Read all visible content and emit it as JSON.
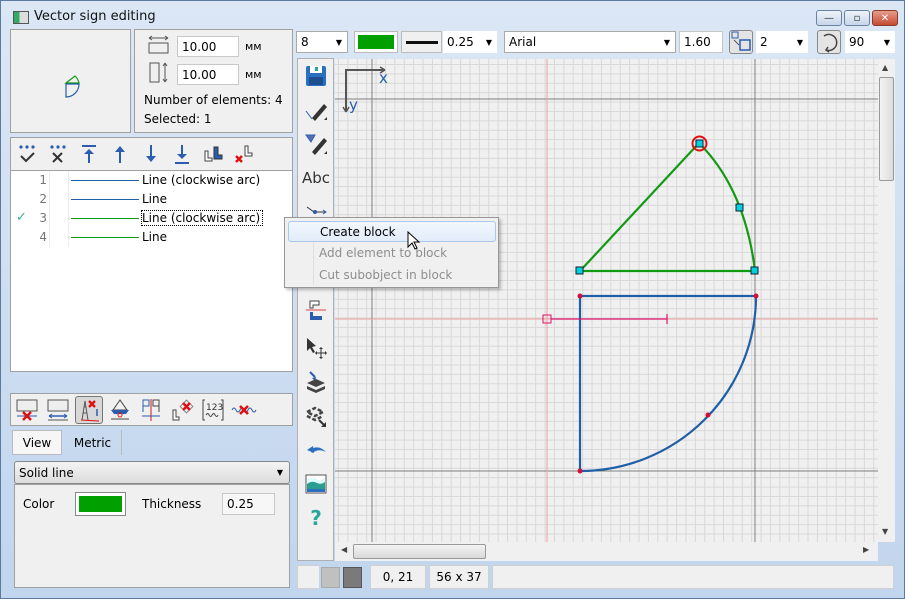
{
  "window": {
    "title": "Vector sign editing",
    "controls": {
      "minimize": "—",
      "maximize": "▫",
      "close": "✕"
    }
  },
  "size_panel": {
    "width_value": "10.00",
    "height_value": "10.00",
    "unit": "мм",
    "elements_label": "Number of elements: 4",
    "selected_label": "Selected: 1"
  },
  "element_list": {
    "toolbar": [
      "select-all-icon",
      "deselect-all-icon",
      "move-top-icon",
      "move-up-icon",
      "move-down-icon",
      "move-bottom-icon",
      "group-icon",
      "ungroup-icon"
    ],
    "rows": [
      {
        "num": "1",
        "check": "",
        "color": "#1f5fa8",
        "label": "Line (clockwise arc)"
      },
      {
        "num": "2",
        "check": "",
        "color": "#1f5fa8",
        "label": "Line"
      },
      {
        "num": "3",
        "check": "✓",
        "color": "#139a13",
        "label": "Line (clockwise arc)"
      },
      {
        "num": "4",
        "check": "",
        "color": "#139a13",
        "label": "Line"
      }
    ]
  },
  "props": {
    "tabs": [
      {
        "label": "View"
      },
      {
        "label": "Metric"
      }
    ],
    "line_style": "Solid line",
    "color_label": "Color",
    "color_value": "#00a000",
    "thickness_label": "Thickness",
    "thickness_value": "0.25"
  },
  "top_toolbar": {
    "size_value": "8",
    "color_value": "#00a000",
    "thickness_value": "0.25",
    "font_value": "Arial",
    "font_size_value": "1.60",
    "step_value": "2",
    "angle_value": "90"
  },
  "canvas": {
    "axis_x_label": "x",
    "axis_y_label": "y"
  },
  "context_menu": {
    "items": [
      {
        "label": "Create block",
        "enabled": true
      },
      {
        "label": "Add element to block",
        "enabled": false
      },
      {
        "label": "Cut subobject in block",
        "enabled": false
      }
    ]
  },
  "status_bar": {
    "coords": "0,  21",
    "size": "56 x 37"
  },
  "colors": {
    "green": "#139a13",
    "blue": "#1f5fa8",
    "node": "#00d0e0",
    "red": "#d00000"
  }
}
